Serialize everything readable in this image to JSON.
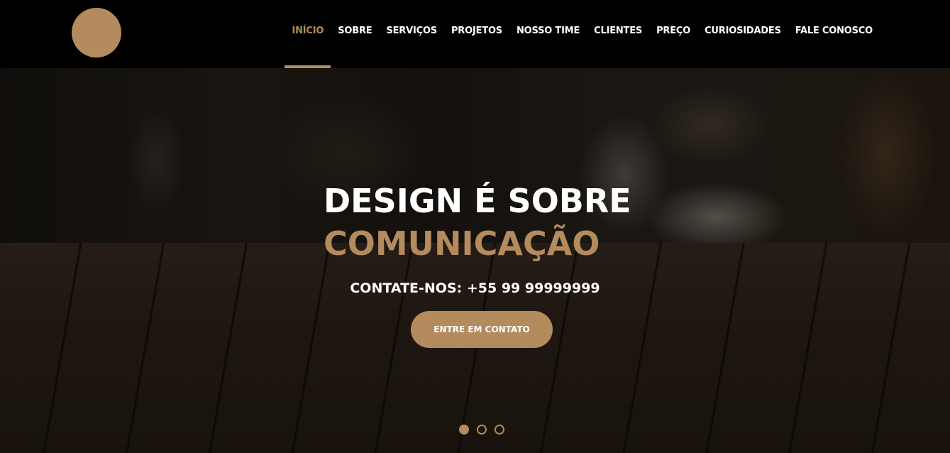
{
  "brand": {
    "accent_color": "#b38b5d"
  },
  "nav": {
    "items": [
      {
        "label": "INÍCIO",
        "active": true
      },
      {
        "label": "SOBRE"
      },
      {
        "label": "SERVIÇOS"
      },
      {
        "label": "PROJETOS"
      },
      {
        "label": "NOSSO TIME"
      },
      {
        "label": "CLIENTES"
      },
      {
        "label": "PREÇO"
      },
      {
        "label": "CURIOSIDADES"
      },
      {
        "label": "FALE CONOSCO"
      }
    ]
  },
  "hero": {
    "title_line1": "DESIGN É SOBRE",
    "title_line2": "COMUNICAÇÃO",
    "contact": "CONTATE-NOS: +55 99 99999999",
    "cta_label": "ENTRE EM CONTATO",
    "slides": {
      "count": 3,
      "active_index": 0
    }
  }
}
